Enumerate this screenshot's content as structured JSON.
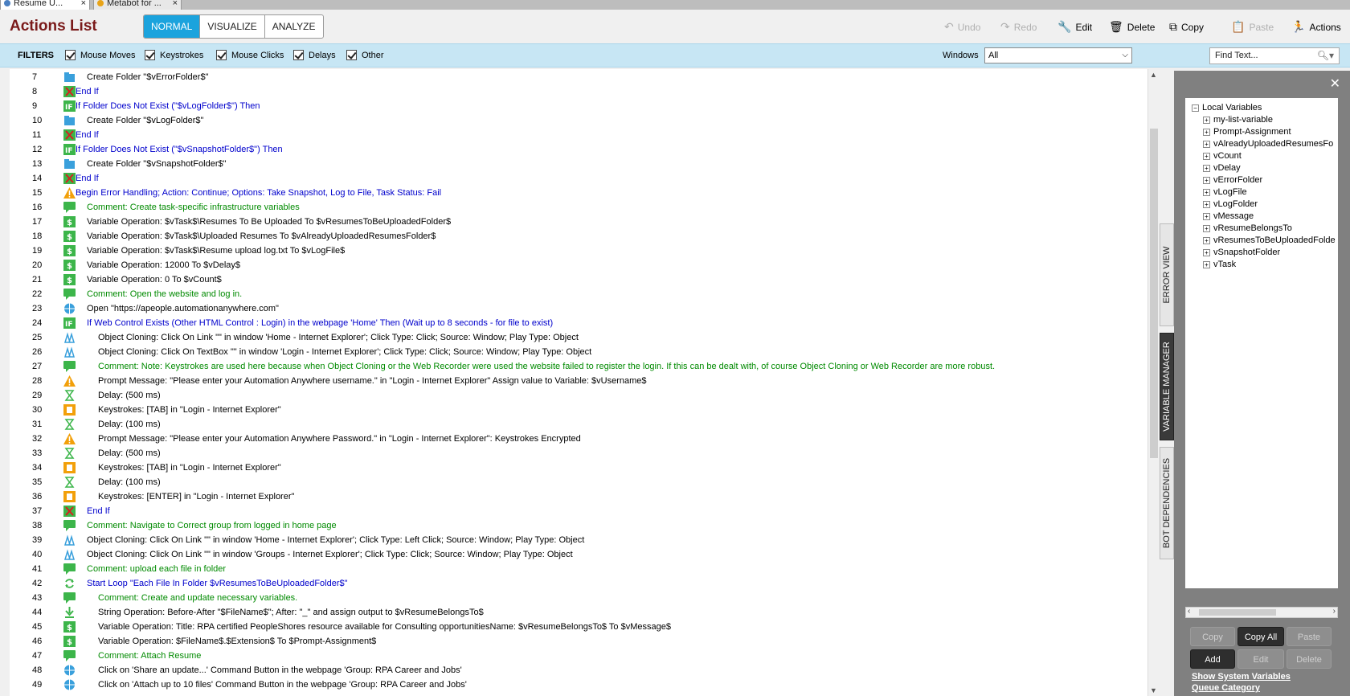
{
  "tabs": [
    {
      "label": "Resume U...",
      "close": "×"
    },
    {
      "label": "Metabot for ...",
      "close": "×"
    }
  ],
  "header": {
    "title": "Actions List",
    "modes": [
      "NORMAL",
      "VISUALIZE",
      "ANALYZE"
    ],
    "active_mode": "NORMAL",
    "toolbar": {
      "undo": "Undo",
      "redo": "Redo",
      "edit": "Edit",
      "delete": "Delete",
      "copy": "Copy",
      "paste": "Paste",
      "actions": "Actions"
    }
  },
  "filters": {
    "label": "FILTERS",
    "items": [
      "Mouse Moves",
      "Keystrokes",
      "Mouse Clicks",
      "Delays",
      "Other"
    ],
    "windows_label": "Windows",
    "windows_value": "All",
    "find_placeholder": "Find Text..."
  },
  "actions": [
    {
      "n": "7",
      "icon": "folder",
      "indent": 1,
      "color": "text",
      "text": "Create Folder \"$vErrorFolder$\""
    },
    {
      "n": "8",
      "icon": "endif",
      "indent": 0,
      "color": "ctrl",
      "text": "End If"
    },
    {
      "n": "9",
      "icon": "if",
      "indent": 0,
      "color": "ctrl",
      "text": "If Folder Does Not Exist (\"$vLogFolder$\")  Then"
    },
    {
      "n": "10",
      "icon": "folder",
      "indent": 1,
      "color": "text",
      "text": "Create Folder \"$vLogFolder$\""
    },
    {
      "n": "11",
      "icon": "endif",
      "indent": 0,
      "color": "ctrl",
      "text": "End If"
    },
    {
      "n": "12",
      "icon": "if",
      "indent": 0,
      "color": "ctrl",
      "text": "If Folder Does Not Exist (\"$vSnapshotFolder$\")  Then"
    },
    {
      "n": "13",
      "icon": "folder",
      "indent": 1,
      "color": "text",
      "text": "Create Folder \"$vSnapshotFolder$\""
    },
    {
      "n": "14",
      "icon": "endif",
      "indent": 0,
      "color": "ctrl",
      "text": "End If"
    },
    {
      "n": "15",
      "icon": "warning",
      "indent": 0,
      "color": "ctrl",
      "text": "Begin Error Handling; Action: Continue; Options: Take Snapshot, Log to File,  Task Status: Fail"
    },
    {
      "n": "16",
      "icon": "comment",
      "indent": 1,
      "color": "comment",
      "text": "Comment: Create task-specific infrastructure variables"
    },
    {
      "n": "17",
      "icon": "variable",
      "indent": 1,
      "color": "text",
      "text": "Variable Operation: $vTask$\\Resumes To Be Uploaded To $vResumesToBeUploadedFolder$"
    },
    {
      "n": "18",
      "icon": "variable",
      "indent": 1,
      "color": "text",
      "text": "Variable Operation: $vTask$\\Uploaded Resumes To $vAlreadyUploadedResumesFolder$"
    },
    {
      "n": "19",
      "icon": "variable",
      "indent": 1,
      "color": "text",
      "text": "Variable Operation: $vTask$\\Resume upload log.txt To $vLogFile$"
    },
    {
      "n": "20",
      "icon": "variable",
      "indent": 1,
      "color": "text",
      "text": "Variable Operation: 12000 To $vDelay$"
    },
    {
      "n": "21",
      "icon": "variable",
      "indent": 1,
      "color": "text",
      "text": "Variable Operation: 0 To $vCount$"
    },
    {
      "n": "22",
      "icon": "comment",
      "indent": 1,
      "color": "comment",
      "text": "Comment: Open the website and log in."
    },
    {
      "n": "23",
      "icon": "web",
      "indent": 1,
      "color": "text",
      "text": "Open \"https://apeople.automationanywhere.com\""
    },
    {
      "n": "24",
      "icon": "if",
      "indent": 1,
      "color": "ctrl",
      "text": "If Web Control Exists (Other HTML Control : Login) in the webpage 'Home' Then (Wait up to 8 seconds - for file to exist)"
    },
    {
      "n": "25",
      "icon": "clone",
      "indent": 2,
      "color": "text",
      "text": "Object Cloning: Click On Link \"\" in window 'Home - Internet Explorer'; Click Type: Click; Source: Window; Play Type: Object"
    },
    {
      "n": "26",
      "icon": "clone",
      "indent": 2,
      "color": "text",
      "text": "Object Cloning: Click On TextBox \"\" in window 'Login - Internet Explorer'; Click Type: Click; Source: Window; Play Type: Object"
    },
    {
      "n": "27",
      "icon": "comment",
      "indent": 2,
      "color": "comment",
      "text": "Comment: Note: Keystrokes are used here because when Object Cloning or the Web Recorder were used the website failed to register the login. If this can be dealt with, of course Object Cloning or Web Recorder are more robust."
    },
    {
      "n": "28",
      "icon": "warning",
      "indent": 2,
      "color": "text",
      "text": "Prompt Message: \"Please enter your Automation Anywhere username.\" in \"Login - Internet Explorer\" Assign value to Variable: $vUsername$"
    },
    {
      "n": "29",
      "icon": "delay",
      "indent": 2,
      "color": "text",
      "text": "Delay: (500 ms)"
    },
    {
      "n": "30",
      "icon": "keys",
      "indent": 2,
      "color": "text",
      "text": "Keystrokes: [TAB] in \"Login - Internet Explorer\""
    },
    {
      "n": "31",
      "icon": "delay",
      "indent": 2,
      "color": "text",
      "text": "Delay: (100 ms)"
    },
    {
      "n": "32",
      "icon": "warning",
      "indent": 2,
      "color": "text",
      "text": "Prompt Message: \"Please enter your Automation Anywhere Password.\" in \"Login - Internet Explorer\": Keystrokes Encrypted"
    },
    {
      "n": "33",
      "icon": "delay",
      "indent": 2,
      "color": "text",
      "text": "Delay: (500 ms)"
    },
    {
      "n": "34",
      "icon": "keys",
      "indent": 2,
      "color": "text",
      "text": "Keystrokes: [TAB] in \"Login - Internet Explorer\""
    },
    {
      "n": "35",
      "icon": "delay",
      "indent": 2,
      "color": "text",
      "text": "Delay: (100 ms)"
    },
    {
      "n": "36",
      "icon": "keys",
      "indent": 2,
      "color": "text",
      "text": "Keystrokes: [ENTER] in \"Login - Internet Explorer\""
    },
    {
      "n": "37",
      "icon": "endif",
      "indent": 1,
      "color": "ctrl",
      "text": "End If"
    },
    {
      "n": "38",
      "icon": "comment",
      "indent": 1,
      "color": "comment",
      "text": "Comment: Navigate to Correct group from logged in home page"
    },
    {
      "n": "39",
      "icon": "clone",
      "indent": 1,
      "color": "text",
      "text": "Object Cloning: Click On Link \"\" in window 'Home - Internet Explorer'; Click Type: Left Click; Source: Window; Play Type: Object"
    },
    {
      "n": "40",
      "icon": "clone",
      "indent": 1,
      "color": "text",
      "text": "Object Cloning: Click On Link \"\" in window 'Groups - Internet Explorer'; Click Type: Click; Source: Window; Play Type: Object"
    },
    {
      "n": "41",
      "icon": "comment",
      "indent": 1,
      "color": "comment",
      "text": "Comment: upload each file in folder"
    },
    {
      "n": "42",
      "icon": "loop",
      "indent": 1,
      "color": "ctrl",
      "text": "Start Loop \"Each File In Folder $vResumesToBeUploadedFolder$\""
    },
    {
      "n": "43",
      "icon": "comment",
      "indent": 2,
      "color": "comment",
      "text": "Comment: Create and update necessary variables."
    },
    {
      "n": "44",
      "icon": "string",
      "indent": 2,
      "color": "text",
      "text": "String Operation: Before-After \"$FileName$\"; After: \"_\" and assign output to $vResumeBelongsTo$"
    },
    {
      "n": "45",
      "icon": "variable",
      "indent": 2,
      "color": "text",
      "text": "Variable Operation: Title: RPA certified PeopleShores resource available for Consulting opportunitiesName: $vResumeBelongsTo$ To $vMessage$"
    },
    {
      "n": "46",
      "icon": "variable",
      "indent": 2,
      "color": "text",
      "text": "Variable Operation: $FileName$.$Extension$ To $Prompt-Assignment$"
    },
    {
      "n": "47",
      "icon": "comment",
      "indent": 2,
      "color": "comment",
      "text": "Comment: Attach Resume"
    },
    {
      "n": "48",
      "icon": "web",
      "indent": 2,
      "color": "text",
      "text": "Click on 'Share an update...' Command Button in the webpage 'Group: RPA Career and Jobs'"
    },
    {
      "n": "49",
      "icon": "web",
      "indent": 2,
      "color": "text",
      "text": "Click on 'Attach up to 10 files' Command Button in the webpage 'Group: RPA Career and Jobs'"
    }
  ],
  "side_tabs": [
    "ERROR VIEW",
    "VARIABLE MANAGER",
    "BOT DEPENDENCIES"
  ],
  "active_side_tab": "VARIABLE MANAGER",
  "variables": {
    "root": "Local Variables",
    "items": [
      "my-list-variable",
      "Prompt-Assignment",
      "vAlreadyUploadedResumesFo",
      "vCount",
      "vDelay",
      "vErrorFolder",
      "vLogFile",
      "vLogFolder",
      "vMessage",
      "vResumeBelongsTo",
      "vResumesToBeUploadedFolde",
      "vSnapshotFolder",
      "vTask"
    ],
    "buttons": {
      "copy": "Copy",
      "copy_all": "Copy All",
      "paste": "Paste",
      "add": "Add",
      "edit": "Edit",
      "delete": "Delete"
    },
    "links": [
      "Show System Variables",
      "Queue Category"
    ]
  },
  "colors": {
    "accent": "#1ba3dd",
    "title": "#7a1a1a",
    "control": "#0000cc",
    "comment": "#008a00",
    "filter_bar": "#c7e6f4",
    "panel": "#808080"
  }
}
